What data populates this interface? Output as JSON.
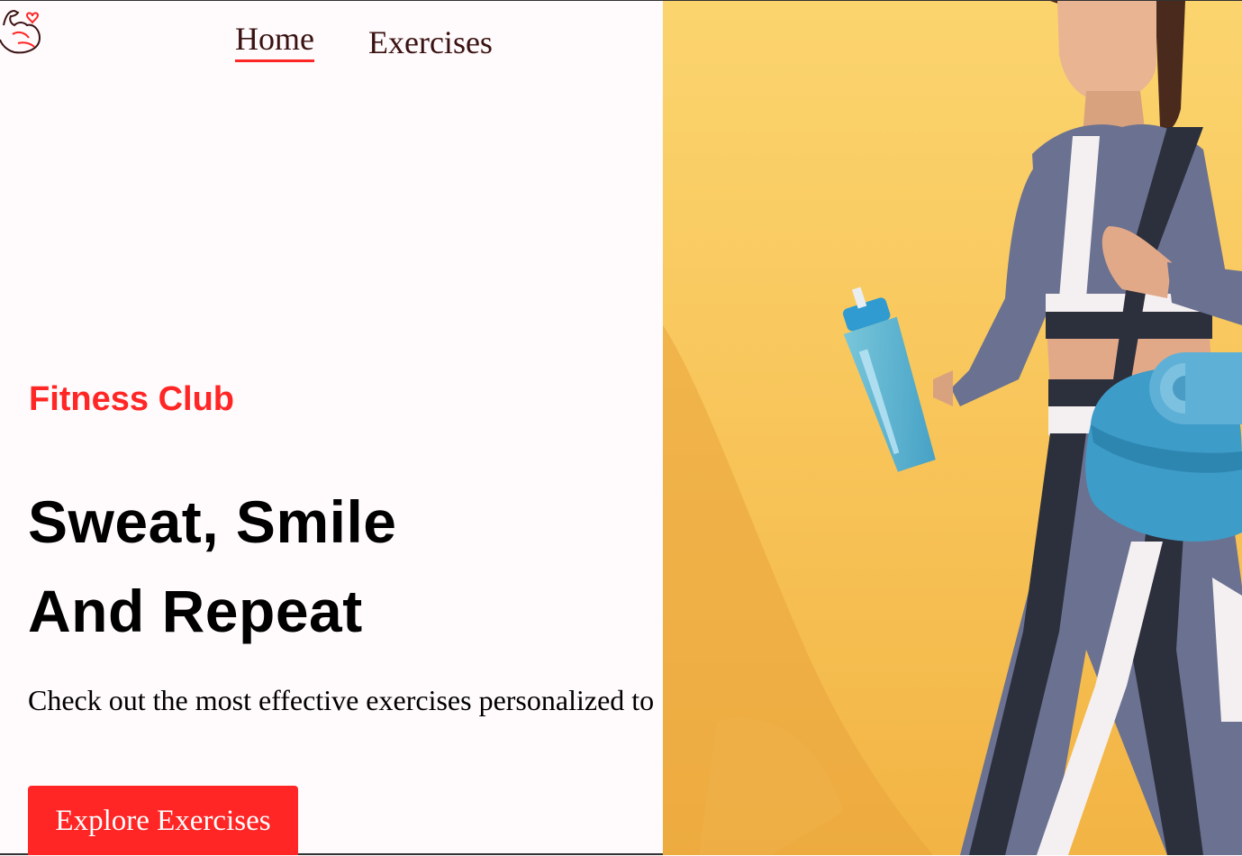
{
  "brand": {
    "logo_icon": "flexed-arm-heart-icon"
  },
  "nav": {
    "items": [
      {
        "label": "Home",
        "active": true
      },
      {
        "label": "Exercises",
        "active": false
      }
    ]
  },
  "hero": {
    "kicker": "Fitness Club",
    "headline_line1": "Sweat, Smile",
    "headline_line2": "And Repeat",
    "subtitle": "Check out the most effective exercises personalized to you",
    "cta_label": "Explore Exercises",
    "image_alt_icon": "woman-with-shaker-and-gym-bag-photo"
  },
  "colors": {
    "accent": "#ff2625",
    "background": "#fffafb",
    "nav_text": "#3a1212",
    "photo_background": "#f8c55a"
  }
}
